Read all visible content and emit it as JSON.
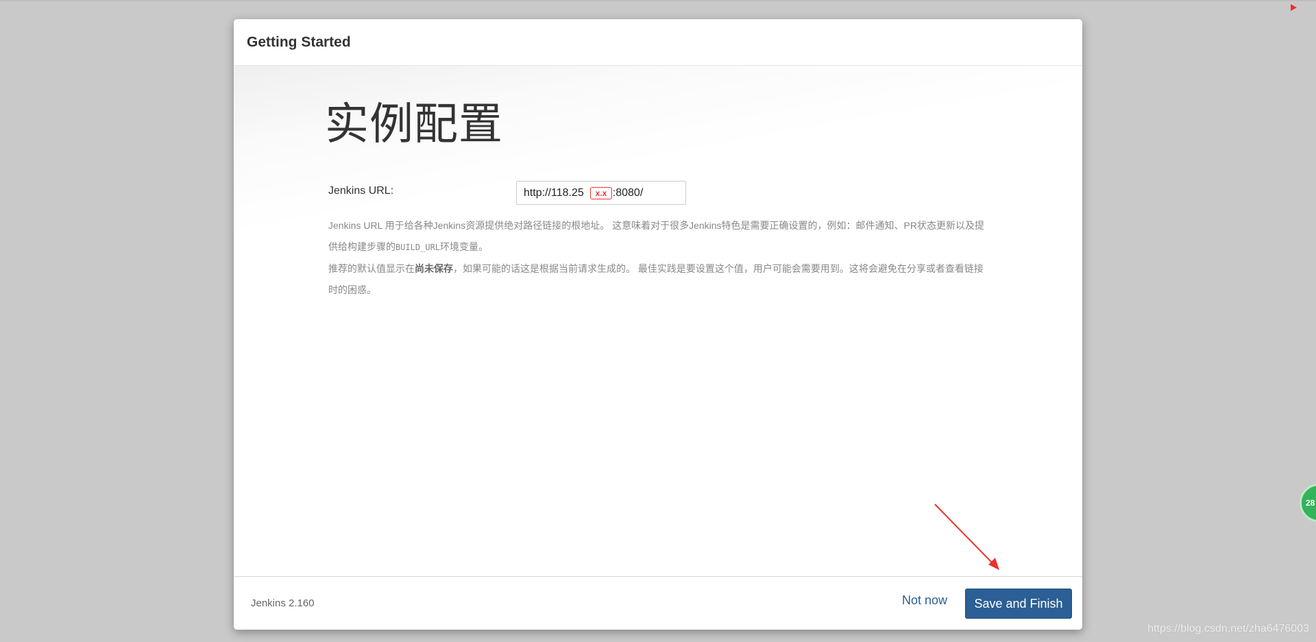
{
  "dialog": {
    "title": "Getting Started",
    "heading": "实例配置",
    "url_label": "Jenkins URL:",
    "url_value": "http://118.25",
    "url_suffix": ":8080/",
    "redaction_mark": "x.x",
    "help": {
      "line1_a": "Jenkins URL 用于给各种Jenkins资源提供绝对路径链接的根地址。 这意味着对于很多Jenkins特色是需要正确设置的，例如：邮件通知、PR状态更新以及提供给构建步骤的",
      "line1_code": "BUILD_URL",
      "line1_b": "环境变量。",
      "line2_a": "推荐的默认值显示在",
      "line2_bold": "尚未保存",
      "line2_b": "，如果可能的话这是根据当前请求生成的。 最佳实践是要设置这个值，用户可能会需要用到。这将会避免在分享或者查看链接时的困惑。"
    }
  },
  "footer": {
    "version": "Jenkins 2.160",
    "not_now": "Not now",
    "save_finish": "Save and Finish"
  },
  "overlay": {
    "badge": "28",
    "watermark": "https://blog.csdn.net/zha6476003"
  },
  "colors": {
    "primary": "#2b5f95",
    "annotation": "#e8322a",
    "badge": "#34b35a"
  }
}
